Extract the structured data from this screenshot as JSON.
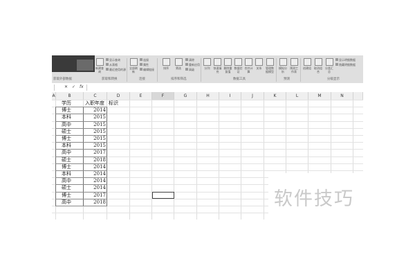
{
  "ribbon": {
    "get_external_data": "获取外部数据",
    "get_and_transform": "获取和转换",
    "connections": "连接",
    "sort_filter": "排序和筛选",
    "data_tools": "数据工具",
    "forecast": "预测",
    "outline": "分级显示",
    "small": {
      "show_query": "显示查询",
      "from_table": "从表格",
      "recent_sources": "最近使用的源",
      "connections": "连接",
      "properties": "属性",
      "edit_links": "编辑链接",
      "clear": "清除",
      "reapply": "重新应用",
      "advanced": "高级",
      "show_detail": "显示明细数据",
      "hide_detail": "隐藏明细数据"
    },
    "commands": {
      "new_query": "新建查询",
      "refresh_all": "全部刷新",
      "sort": "排序",
      "filter": "筛选",
      "text_to_columns": "分列",
      "flash_fill": "快速填充",
      "remove_duplicates": "删除重复值",
      "data_validation": "数据验证",
      "consolidate": "合并计算",
      "relationships": "关系",
      "manage_model": "管理数据模型",
      "what_if": "模拟分析",
      "forecast_sheet": "预测工作表",
      "group": "创建组",
      "ungroup": "取消组合",
      "subtotal": "分类汇总"
    }
  },
  "formula_bar": {
    "cancel": "✕",
    "enter": "✓",
    "fx": "fx"
  },
  "columns": [
    "A",
    "B",
    "C",
    "D",
    "E",
    "F",
    "G",
    "H",
    "I",
    "J",
    "K",
    "L",
    "M",
    "N"
  ],
  "selected_column": "F",
  "header_row": {
    "education": "学历",
    "year": "入职年度",
    "flag": "标识"
  },
  "rows": [
    {
      "education": "博士",
      "year": "2014"
    },
    {
      "education": "本科",
      "year": "2015"
    },
    {
      "education": "高中",
      "year": "2015"
    },
    {
      "education": "硕士",
      "year": "2015"
    },
    {
      "education": "博士",
      "year": "2015"
    },
    {
      "education": "本科",
      "year": "2015"
    },
    {
      "education": "高中",
      "year": "2017"
    },
    {
      "education": "硕士",
      "year": "2018"
    },
    {
      "education": "博士",
      "year": "2014"
    },
    {
      "education": "本科",
      "year": "2014"
    },
    {
      "education": "高中",
      "year": "2014"
    },
    {
      "education": "硕士",
      "year": "2014"
    },
    {
      "education": "博士",
      "year": "2017"
    },
    {
      "education": "高中",
      "year": "2018"
    }
  ],
  "watermark": "软件技巧"
}
